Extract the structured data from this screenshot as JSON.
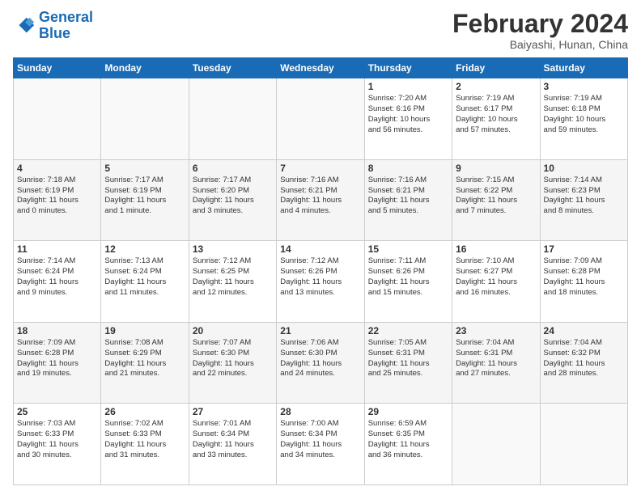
{
  "header": {
    "logo_line1": "General",
    "logo_line2": "Blue",
    "month": "February 2024",
    "location": "Baiyashi, Hunan, China"
  },
  "weekdays": [
    "Sunday",
    "Monday",
    "Tuesday",
    "Wednesday",
    "Thursday",
    "Friday",
    "Saturday"
  ],
  "weeks": [
    [
      {
        "day": "",
        "info": ""
      },
      {
        "day": "",
        "info": ""
      },
      {
        "day": "",
        "info": ""
      },
      {
        "day": "",
        "info": ""
      },
      {
        "day": "1",
        "info": "Sunrise: 7:20 AM\nSunset: 6:16 PM\nDaylight: 10 hours\nand 56 minutes."
      },
      {
        "day": "2",
        "info": "Sunrise: 7:19 AM\nSunset: 6:17 PM\nDaylight: 10 hours\nand 57 minutes."
      },
      {
        "day": "3",
        "info": "Sunrise: 7:19 AM\nSunset: 6:18 PM\nDaylight: 10 hours\nand 59 minutes."
      }
    ],
    [
      {
        "day": "4",
        "info": "Sunrise: 7:18 AM\nSunset: 6:19 PM\nDaylight: 11 hours\nand 0 minutes."
      },
      {
        "day": "5",
        "info": "Sunrise: 7:17 AM\nSunset: 6:19 PM\nDaylight: 11 hours\nand 1 minute."
      },
      {
        "day": "6",
        "info": "Sunrise: 7:17 AM\nSunset: 6:20 PM\nDaylight: 11 hours\nand 3 minutes."
      },
      {
        "day": "7",
        "info": "Sunrise: 7:16 AM\nSunset: 6:21 PM\nDaylight: 11 hours\nand 4 minutes."
      },
      {
        "day": "8",
        "info": "Sunrise: 7:16 AM\nSunset: 6:21 PM\nDaylight: 11 hours\nand 5 minutes."
      },
      {
        "day": "9",
        "info": "Sunrise: 7:15 AM\nSunset: 6:22 PM\nDaylight: 11 hours\nand 7 minutes."
      },
      {
        "day": "10",
        "info": "Sunrise: 7:14 AM\nSunset: 6:23 PM\nDaylight: 11 hours\nand 8 minutes."
      }
    ],
    [
      {
        "day": "11",
        "info": "Sunrise: 7:14 AM\nSunset: 6:24 PM\nDaylight: 11 hours\nand 9 minutes."
      },
      {
        "day": "12",
        "info": "Sunrise: 7:13 AM\nSunset: 6:24 PM\nDaylight: 11 hours\nand 11 minutes."
      },
      {
        "day": "13",
        "info": "Sunrise: 7:12 AM\nSunset: 6:25 PM\nDaylight: 11 hours\nand 12 minutes."
      },
      {
        "day": "14",
        "info": "Sunrise: 7:12 AM\nSunset: 6:26 PM\nDaylight: 11 hours\nand 13 minutes."
      },
      {
        "day": "15",
        "info": "Sunrise: 7:11 AM\nSunset: 6:26 PM\nDaylight: 11 hours\nand 15 minutes."
      },
      {
        "day": "16",
        "info": "Sunrise: 7:10 AM\nSunset: 6:27 PM\nDaylight: 11 hours\nand 16 minutes."
      },
      {
        "day": "17",
        "info": "Sunrise: 7:09 AM\nSunset: 6:28 PM\nDaylight: 11 hours\nand 18 minutes."
      }
    ],
    [
      {
        "day": "18",
        "info": "Sunrise: 7:09 AM\nSunset: 6:28 PM\nDaylight: 11 hours\nand 19 minutes."
      },
      {
        "day": "19",
        "info": "Sunrise: 7:08 AM\nSunset: 6:29 PM\nDaylight: 11 hours\nand 21 minutes."
      },
      {
        "day": "20",
        "info": "Sunrise: 7:07 AM\nSunset: 6:30 PM\nDaylight: 11 hours\nand 22 minutes."
      },
      {
        "day": "21",
        "info": "Sunrise: 7:06 AM\nSunset: 6:30 PM\nDaylight: 11 hours\nand 24 minutes."
      },
      {
        "day": "22",
        "info": "Sunrise: 7:05 AM\nSunset: 6:31 PM\nDaylight: 11 hours\nand 25 minutes."
      },
      {
        "day": "23",
        "info": "Sunrise: 7:04 AM\nSunset: 6:31 PM\nDaylight: 11 hours\nand 27 minutes."
      },
      {
        "day": "24",
        "info": "Sunrise: 7:04 AM\nSunset: 6:32 PM\nDaylight: 11 hours\nand 28 minutes."
      }
    ],
    [
      {
        "day": "25",
        "info": "Sunrise: 7:03 AM\nSunset: 6:33 PM\nDaylight: 11 hours\nand 30 minutes."
      },
      {
        "day": "26",
        "info": "Sunrise: 7:02 AM\nSunset: 6:33 PM\nDaylight: 11 hours\nand 31 minutes."
      },
      {
        "day": "27",
        "info": "Sunrise: 7:01 AM\nSunset: 6:34 PM\nDaylight: 11 hours\nand 33 minutes."
      },
      {
        "day": "28",
        "info": "Sunrise: 7:00 AM\nSunset: 6:34 PM\nDaylight: 11 hours\nand 34 minutes."
      },
      {
        "day": "29",
        "info": "Sunrise: 6:59 AM\nSunset: 6:35 PM\nDaylight: 11 hours\nand 36 minutes."
      },
      {
        "day": "",
        "info": ""
      },
      {
        "day": "",
        "info": ""
      }
    ]
  ]
}
